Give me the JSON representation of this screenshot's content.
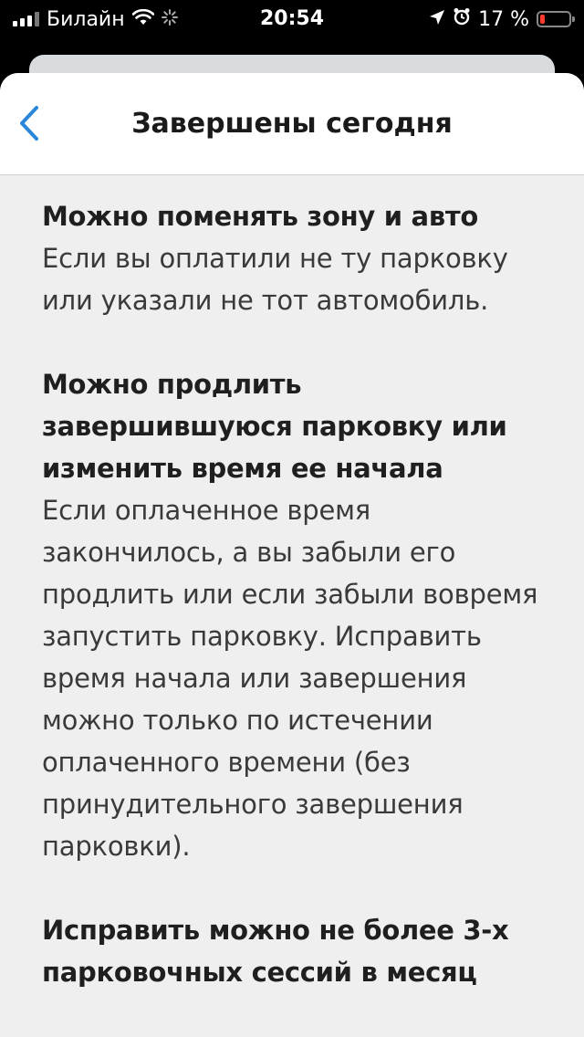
{
  "status_bar": {
    "carrier": "Билайн",
    "time": "20:54",
    "battery_percent": "17 %",
    "battery_level": 0.17,
    "battery_color": "#ff3b30",
    "icons": [
      "signal-icon",
      "wifi-icon",
      "spinner-icon",
      "location-icon",
      "alarm-icon",
      "battery-icon"
    ]
  },
  "header": {
    "title": "Завершены сегодня",
    "back_icon": "chevron-left-icon",
    "accent_color": "#2a86d8"
  },
  "sections": [
    {
      "title": "Можно поменять зону и авто",
      "text": "Если вы оплатили не ту парковку или указали не тот автомобиль."
    },
    {
      "title": "Можно продлить завершившуюся парковку или изменить время ее начала",
      "text": "Если оплаченное время закончилось, а вы забыли его продлить или если забыли вовремя запустить парковку. Исправить время начала или завершения можно только по истечении оплаченного времени (без принудительного завершения парковки)."
    },
    {
      "title": "Исправить можно не более 3-х парковочных сессий в месяц",
      "text": ""
    }
  ]
}
